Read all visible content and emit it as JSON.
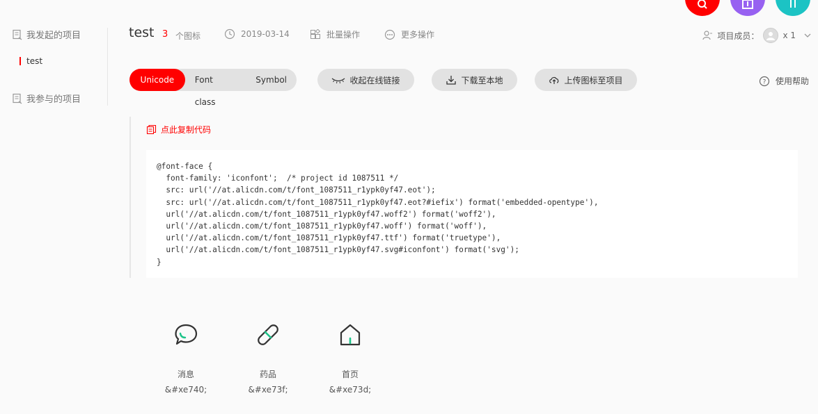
{
  "sidebar": {
    "my_projects": "我发起的项目",
    "active_project": "test",
    "joined_projects": "我参与的项目"
  },
  "project": {
    "title": "test",
    "icon_count": "3",
    "icon_count_label": "个图标",
    "date": "2019-03-14",
    "batch_ops": "批量操作",
    "more_ops": "更多操作",
    "members_label": "项目成员：",
    "members_count": "x 1"
  },
  "toolbar": {
    "tabs": [
      "Unicode",
      "Font class",
      "Symbol"
    ],
    "active_tab": "Unicode",
    "collapse_link": "收起在线链接",
    "download": "下载至本地",
    "upload": "上传图标至项目",
    "help": "使用帮助"
  },
  "code_panel": {
    "copy_label": "点此复制代码",
    "code": "@font-face {\n  font-family: 'iconfont';  /* project id 1087511 */\n  src: url('//at.alicdn.com/t/font_1087511_r1ypk0yf47.eot');\n  src: url('//at.alicdn.com/t/font_1087511_r1ypk0yf47.eot?#iefix') format('embedded-opentype'),\n  url('//at.alicdn.com/t/font_1087511_r1ypk0yf47.woff2') format('woff2'),\n  url('//at.alicdn.com/t/font_1087511_r1ypk0yf47.woff') format('woff'),\n  url('//at.alicdn.com/t/font_1087511_r1ypk0yf47.ttf') format('truetype'),\n  url('//at.alicdn.com/t/font_1087511_r1ypk0yf47.svg#iconfont') format('svg');\n}"
  },
  "icons": [
    {
      "name": "消息",
      "code": "&#xe740;",
      "icon": "message-icon"
    },
    {
      "name": "药品",
      "code": "&#xe73f;",
      "icon": "pill-icon"
    },
    {
      "name": "首页",
      "code": "&#xe73d;",
      "icon": "home-icon"
    }
  ],
  "colors": {
    "accent": "#ff0000",
    "purple": "#9761f1",
    "teal": "#1cc3c4",
    "icon_green": "#1ec48a"
  }
}
